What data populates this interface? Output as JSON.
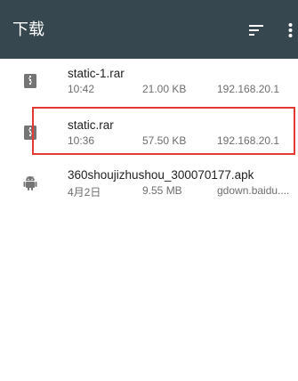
{
  "appbar": {
    "title": "下载"
  },
  "colors": {
    "appbar_bg": "#37474f",
    "highlight": "#e53935"
  },
  "files": [
    {
      "name": "static-1.rar",
      "time": "10:42",
      "size": "21.00 KB",
      "host": "192.168.20.1",
      "icon": "archive-icon"
    },
    {
      "name": "static.rar",
      "time": "10:36",
      "size": "57.50 KB",
      "host": "192.168.20.1",
      "icon": "archive-icon"
    },
    {
      "name": "360shoujizhushou_300070177.apk",
      "time": "4月2日",
      "size": "9.55 MB",
      "host": "gdown.baidu....",
      "icon": "android-icon"
    }
  ]
}
